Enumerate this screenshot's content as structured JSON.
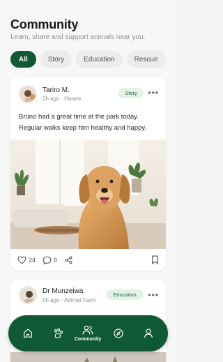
{
  "header": {
    "title": "Community",
    "subtitle": "Learn, share and support animals near you."
  },
  "filters": [
    {
      "label": "All",
      "active": true
    },
    {
      "label": "Story",
      "active": false
    },
    {
      "label": "Education",
      "active": false
    },
    {
      "label": "Rescue",
      "active": false
    }
  ],
  "posts": [
    {
      "author": "Tariro M.",
      "time": "2h ago",
      "location": "Harare",
      "tag": "Story",
      "text": "Bruno had a great time at the park today. Regular walks keep him healthy and happy.",
      "likes": "24",
      "comments": "6"
    },
    {
      "author": "Dr Munzeiwa",
      "time": "5h ago",
      "location": "Animal Farm",
      "tag": "Education"
    }
  ],
  "nav": {
    "active": "Community",
    "items": [
      {
        "icon": "home-icon",
        "label": ""
      },
      {
        "icon": "paw-icon",
        "label": ""
      },
      {
        "icon": "people-icon",
        "label": "Community"
      },
      {
        "icon": "compass-icon",
        "label": ""
      },
      {
        "icon": "profile-icon",
        "label": ""
      }
    ]
  },
  "colors": {
    "primary": "#0f5a34",
    "tag_bg": "#e4f3e8",
    "tag_text": "#1b6a3e",
    "chip_bg": "#ececec"
  }
}
